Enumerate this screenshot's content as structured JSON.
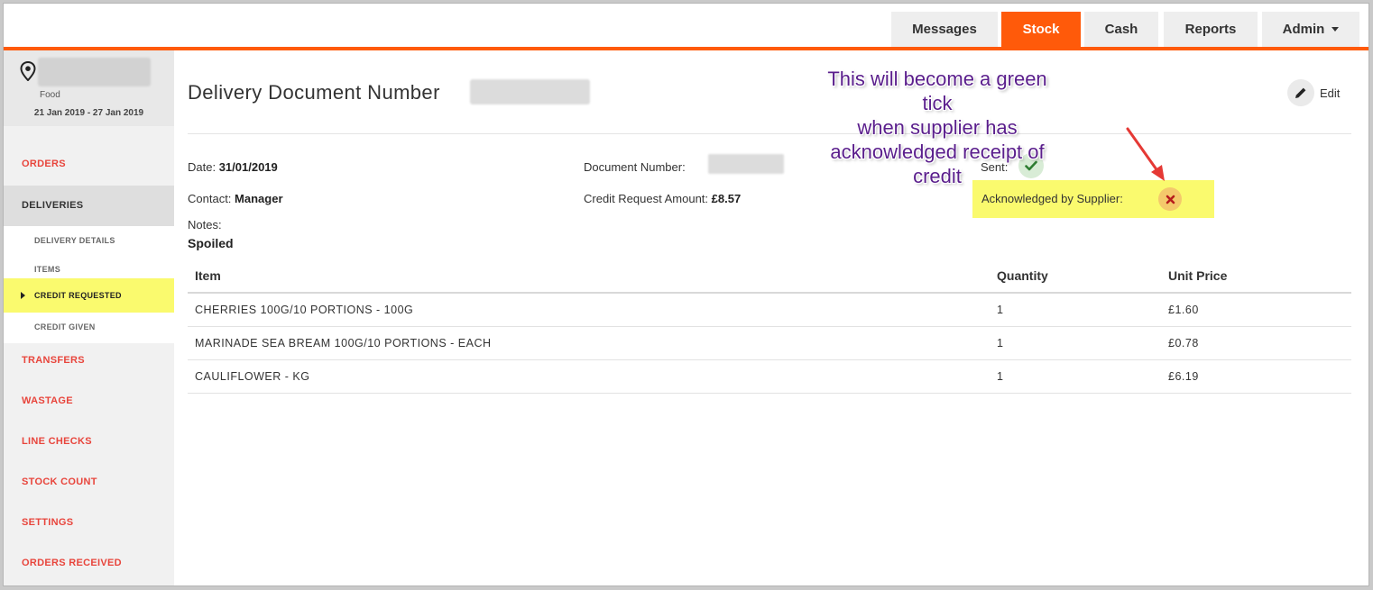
{
  "nav": {
    "tabs": [
      {
        "label": "Messages",
        "active": false
      },
      {
        "label": "Stock",
        "active": true
      },
      {
        "label": "Cash",
        "active": false
      },
      {
        "label": "Reports",
        "active": false
      },
      {
        "label": "Admin",
        "active": false
      }
    ]
  },
  "sidebar": {
    "site_type": "Food",
    "date_range": "21 Jan 2019 - 27 Jan 2019",
    "links": {
      "orders": "ORDERS",
      "deliveries": "DELIVERIES",
      "transfers": "TRANSFERS",
      "wastage": "WASTAGE",
      "line_checks": "LINE CHECKS",
      "stock_count": "STOCK COUNT",
      "settings": "SETTINGS",
      "orders_received": "ORDERS RECEIVED"
    },
    "sub_items": {
      "delivery_details": "DELIVERY DETAILS",
      "items": "ITEMS",
      "credit_requested": "CREDIT REQUESTED",
      "credit_given": "CREDIT GIVEN"
    }
  },
  "main": {
    "title": "Delivery Document Number",
    "edit_label": "Edit",
    "date_label": "Date:",
    "date_value": "31/01/2019",
    "contact_label": "Contact:",
    "contact_value": "Manager",
    "docnum_label": "Document Number:",
    "credit_label": "Credit Request Amount:",
    "credit_value": "£8.57",
    "sent_label": "Sent:",
    "ack_label": "Acknowledged by Supplier:",
    "notes_label": "Notes:",
    "notes_value": "Spoiled",
    "table": {
      "headers": {
        "item": "Item",
        "quantity": "Quantity",
        "unit_price": "Unit Price"
      },
      "rows": [
        {
          "item": "CHERRIES 100G/10 PORTIONS - 100G",
          "quantity": "1",
          "unit_price": "£1.60"
        },
        {
          "item": "MARINADE SEA BREAM 100G/10 PORTIONS - EACH",
          "quantity": "1",
          "unit_price": "£0.78"
        },
        {
          "item": "CAULIFLOWER - KG",
          "quantity": "1",
          "unit_price": "£6.19"
        }
      ]
    }
  },
  "annotation": {
    "line1": "This will become a green tick",
    "line2": "when supplier has",
    "line3": "acknowledged receipt of credit"
  },
  "colors": {
    "brand_orange": "#ff5a0a",
    "link_red": "#e8453c",
    "highlight_yellow": "#fafa6e",
    "annotation_purple": "#5a1e8c",
    "arrow_red": "#e53935"
  }
}
